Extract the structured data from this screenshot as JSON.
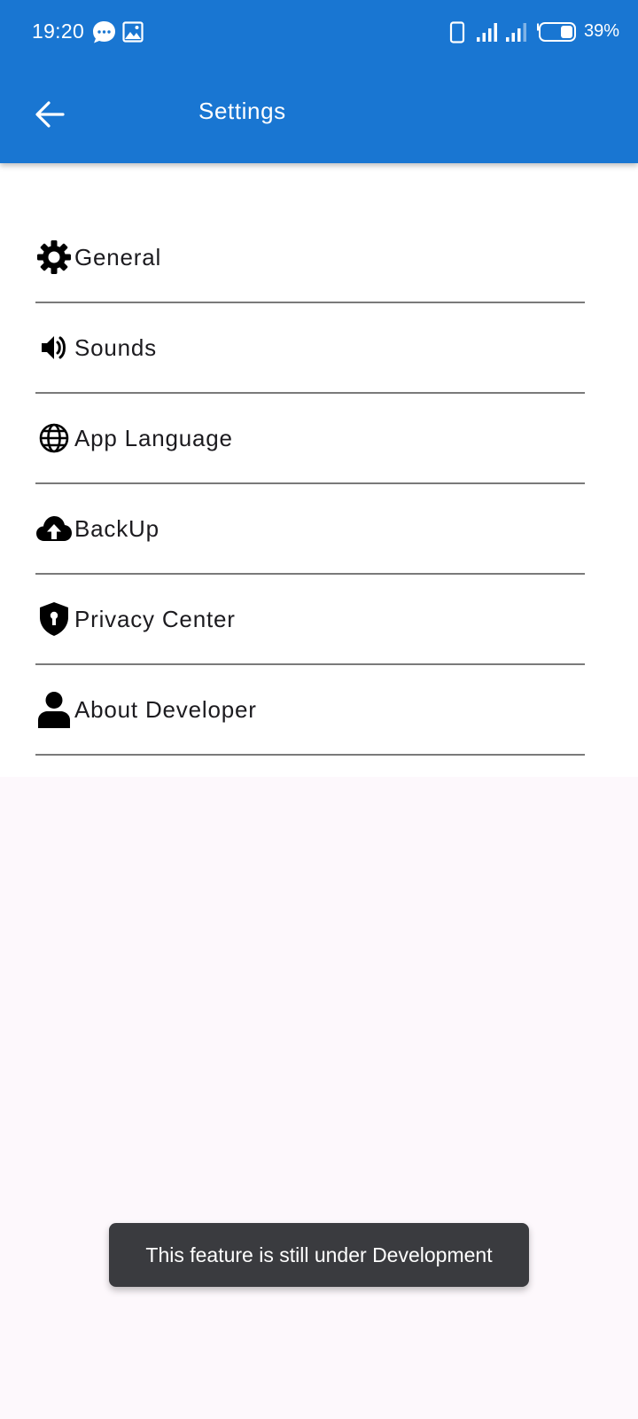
{
  "status_bar": {
    "time": "19:20",
    "battery": "39%",
    "icons": [
      "message-bubble-icon",
      "image-icon",
      "phone-icon",
      "signal-icon",
      "signal-icon",
      "battery-icon"
    ]
  },
  "toolbar": {
    "back_icon": "arrow-back-icon",
    "title": "Settings"
  },
  "settings": {
    "items": [
      {
        "label": "General",
        "icon": "gear-icon"
      },
      {
        "label": "Sounds",
        "icon": "speaker-icon"
      },
      {
        "label": "App Language",
        "icon": "globe-icon"
      },
      {
        "label": "BackUp",
        "icon": "cloud-upload-icon"
      },
      {
        "label": "Privacy Center",
        "icon": "shield-lock-icon"
      },
      {
        "label": "About Developer",
        "icon": "person-icon"
      }
    ]
  },
  "toast": {
    "message": "This feature is still under Development"
  },
  "colors": {
    "app_bar": "#1976d2",
    "background": "#fdf8fc",
    "list_background": "#ffffff",
    "divider": "#7a7a7a",
    "toast_background": "#3a3b3f"
  }
}
